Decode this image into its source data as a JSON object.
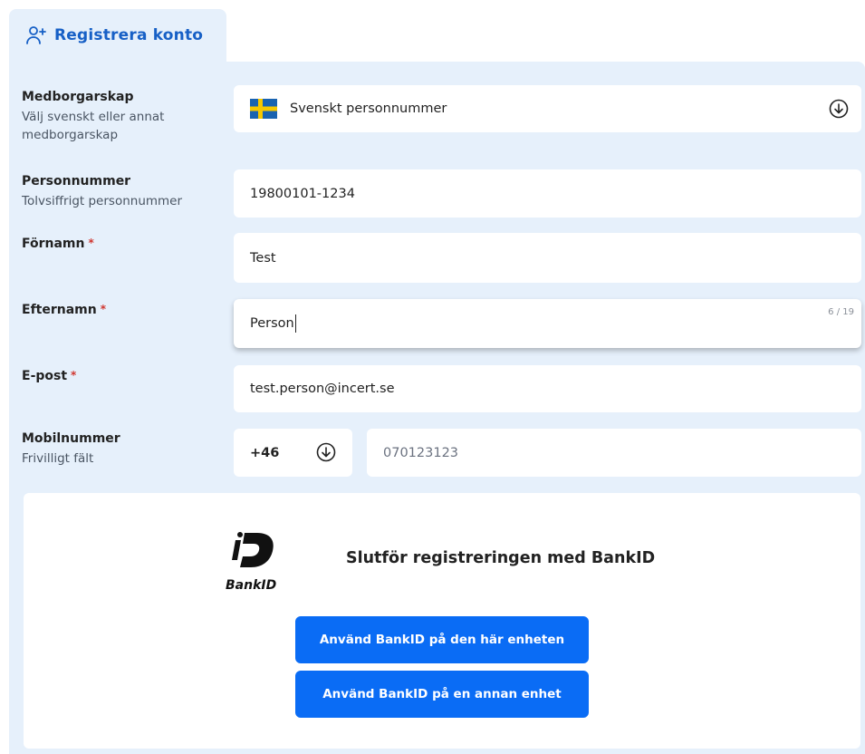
{
  "tab": {
    "label": "Registrera konto",
    "icon": "add-user-icon"
  },
  "form": {
    "citizenship": {
      "label": "Medborgarskap",
      "hint": "Välj svenskt eller annat medborgarskap",
      "value": "Svenskt personnummer",
      "flag": "sweden-flag-icon"
    },
    "personnummer": {
      "label": "Personnummer",
      "hint": "Tolvsiffrigt personnummer",
      "value": "19800101-1234"
    },
    "fornamn": {
      "label": "Förnamn",
      "required": "*",
      "value": "Test"
    },
    "efternamn": {
      "label": "Efternamn",
      "required": "*",
      "value": "Person",
      "counter": "6 / 19"
    },
    "epost": {
      "label": "E-post",
      "required": "*",
      "value": "test.person@incert.se"
    },
    "mobil": {
      "label": "Mobilnummer",
      "hint": "Frivilligt fält",
      "country_code": "+46",
      "placeholder": "070123123"
    }
  },
  "bankid": {
    "logo_text": "BankID",
    "title": "Slutför registreringen med BankID",
    "button_this_device": "Använd BankID på den här enheten",
    "button_other_device": "Använd BankID på en annan enhet"
  },
  "colors": {
    "accent": "#1760c6",
    "panel": "#e6f0fb",
    "button": "#0a6cf5",
    "required": "#d0362f"
  }
}
